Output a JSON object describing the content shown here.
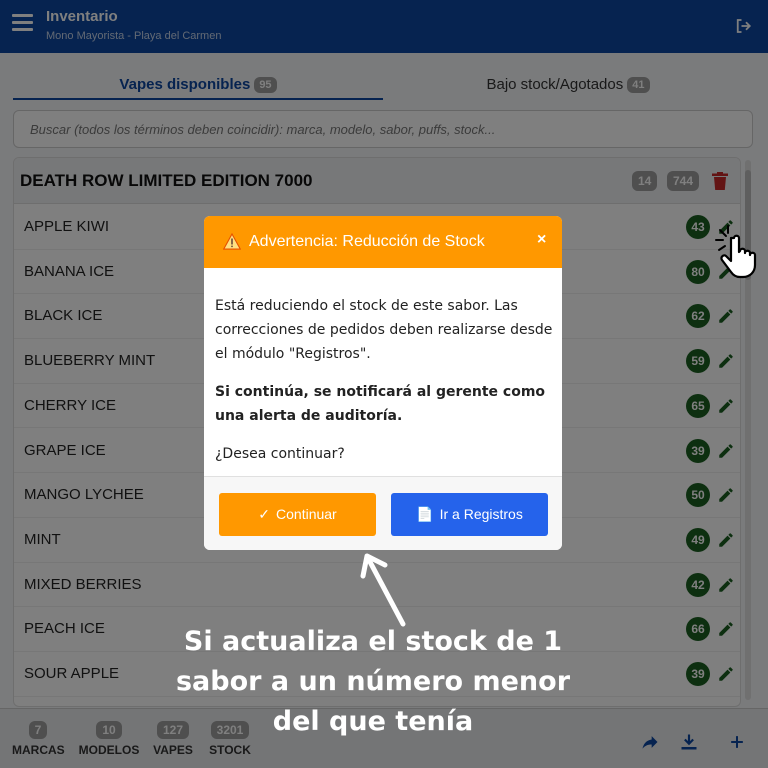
{
  "header": {
    "title": "Inventario",
    "subtitle": "Mono Mayorista - Playa del Carmen"
  },
  "tabs": [
    {
      "label": "Vapes disponibles",
      "count": "95"
    },
    {
      "label": "Bajo stock/Agotados",
      "count": "41"
    }
  ],
  "search": {
    "placeholder": "Buscar (todos los términos deben coincidir): marca, modelo, sabor, puffs, stock..."
  },
  "group": {
    "title": "DEATH ROW LIMITED EDITION 7000",
    "flavor_count": "14",
    "stock_total": "744"
  },
  "flavors": [
    {
      "name": "APPLE KIWI",
      "stock": "43"
    },
    {
      "name": "BANANA ICE",
      "stock": "80"
    },
    {
      "name": "BLACK ICE",
      "stock": "62"
    },
    {
      "name": "BLUEBERRY MINT",
      "stock": "59"
    },
    {
      "name": "CHERRY ICE",
      "stock": "65"
    },
    {
      "name": "GRAPE ICE",
      "stock": "39"
    },
    {
      "name": "MANGO LYCHEE",
      "stock": "50"
    },
    {
      "name": "MINT",
      "stock": "49"
    },
    {
      "name": "MIXED BERRIES",
      "stock": "42"
    },
    {
      "name": "PEACH ICE",
      "stock": "66"
    },
    {
      "name": "SOUR APPLE",
      "stock": "39"
    }
  ],
  "stats": [
    {
      "value": "7",
      "label": "MARCAS"
    },
    {
      "value": "10",
      "label": "MODELOS"
    },
    {
      "value": "127",
      "label": "VAPES"
    },
    {
      "value": "3201",
      "label": "STOCK"
    }
  ],
  "modal": {
    "title": "Advertencia: Reducción de Stock",
    "close": "×",
    "body1": "Está reduciendo el stock de este sabor. Las correcciones de pedidos deben realizarse desde el módulo \"Registros\".",
    "body2": "Si continúa, se notificará al gerente como una alerta de auditoría.",
    "body3": "¿Desea continuar?",
    "continue_glyph": "✓",
    "continue_label": "Continuar",
    "registros_glyph": "📄",
    "registros_label": "Ir a Registros"
  },
  "annotation": {
    "caption": "Si actualiza el stock de 1 sabor a un número menor del que tenía"
  },
  "colors": {
    "header": "#0d47a1",
    "warning": "#ff9800",
    "primary": "#2563eb",
    "stock_badge": "#1b5e20",
    "edit_icon": "#1b5e20",
    "trash": "#c62828"
  },
  "icons": [
    "menu-icon",
    "logout-icon",
    "trash-icon",
    "edit-icon",
    "warning-icon",
    "close-icon",
    "share-icon",
    "download-icon",
    "plus-icon",
    "pointing-hand-icon"
  ]
}
